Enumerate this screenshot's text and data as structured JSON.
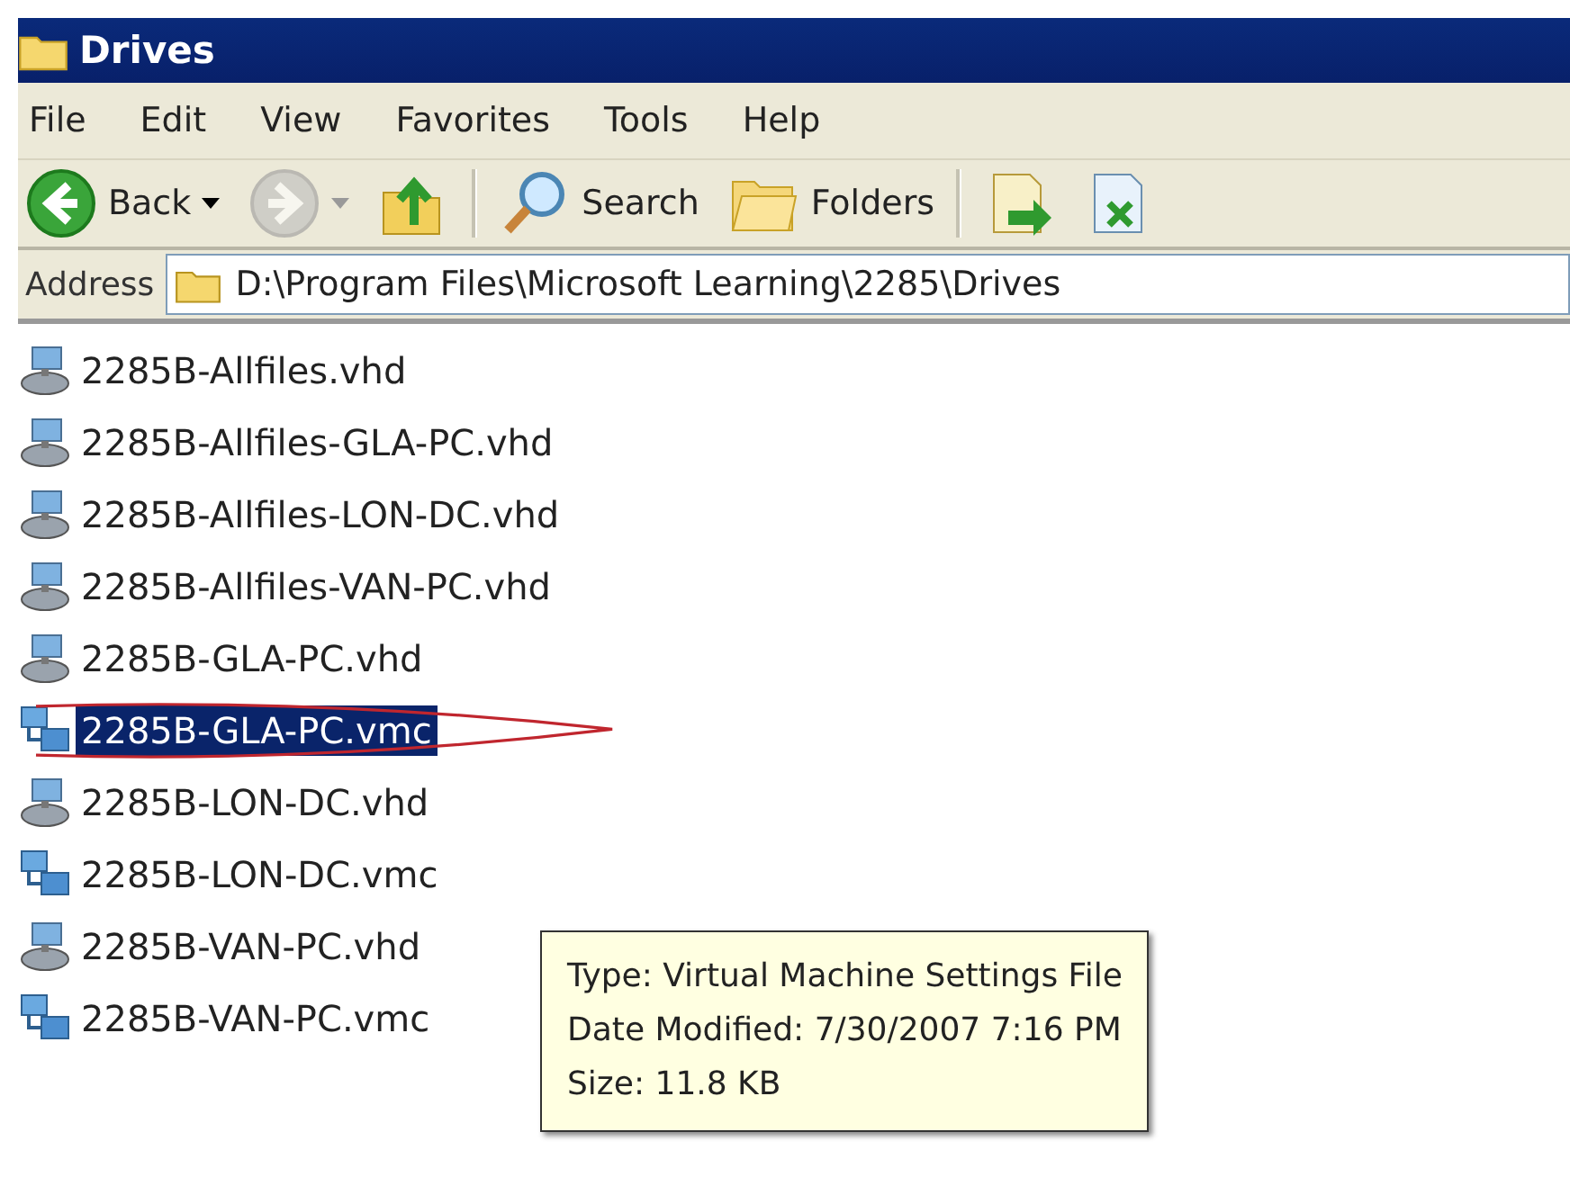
{
  "window": {
    "title": "Drives"
  },
  "menu": [
    "File",
    "Edit",
    "View",
    "Favorites",
    "Tools",
    "Help"
  ],
  "toolbar": [
    {
      "kind": "back",
      "label": "Back",
      "disabled": false
    },
    {
      "kind": "forward",
      "disabled": true
    },
    {
      "kind": "up",
      "disabled": false
    },
    {
      "kind": "search",
      "label": "Search",
      "disabled": false
    },
    {
      "kind": "folders",
      "label": "Folders",
      "disabled": false
    },
    {
      "kind": "move",
      "disabled": false
    },
    {
      "kind": "copy",
      "disabled": false
    }
  ],
  "address": {
    "label": "Address",
    "value": "D:\\Program Files\\Microsoft Learning\\2285\\Drives"
  },
  "files": [
    {
      "name": "2285B-Allfiles.vhd",
      "kind": "vhd",
      "selected": false
    },
    {
      "name": "2285B-Allfiles-GLA-PC.vhd",
      "kind": "vhd",
      "selected": false
    },
    {
      "name": "2285B-Allfiles-LON-DC.vhd",
      "kind": "vhd",
      "selected": false
    },
    {
      "name": "2285B-Allfiles-VAN-PC.vhd",
      "kind": "vhd",
      "selected": false
    },
    {
      "name": "2285B-GLA-PC.vhd",
      "kind": "vhd",
      "selected": false
    },
    {
      "name": "2285B-GLA-PC.vmc",
      "kind": "vmc",
      "selected": true
    },
    {
      "name": "2285B-LON-DC.vhd",
      "kind": "vhd",
      "selected": false
    },
    {
      "name": "2285B-LON-DC.vmc",
      "kind": "vmc",
      "selected": false
    },
    {
      "name": "2285B-VAN-PC.vhd",
      "kind": "vhd",
      "selected": false
    },
    {
      "name": "2285B-VAN-PC.vmc",
      "kind": "vmc",
      "selected": false
    }
  ],
  "tooltip": [
    "Type: Virtual Machine Settings File",
    "Date Modified: 7/30/2007 7:16 PM",
    "Size: 11.8 KB"
  ]
}
